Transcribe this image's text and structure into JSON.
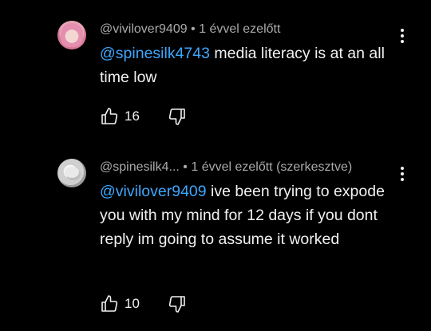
{
  "comments": [
    {
      "username": "@vivilover9409",
      "separator": " • ",
      "time": "1 évvel ezelőtt",
      "edited": "",
      "mention": "@spinesilk4743",
      "text": " media literacy is at an all time low",
      "likes": "16",
      "avatar_icon": "pink-hair-avatar-icon"
    },
    {
      "username": "@spinesilk4...",
      "separator": " • ",
      "time": "1 évvel ezelőtt",
      "edited": "(szerkesztve)",
      "mention": "@vivilover9409",
      "text": " ive been trying to expode you with my mind for 12 days if you dont reply im going to assume it worked",
      "likes": "10",
      "avatar_icon": "white-blob-avatar-icon"
    }
  ],
  "colors": {
    "background": "#000000",
    "text": "#f1f1f1",
    "meta": "#aaaaaa",
    "mention": "#3ea6ff"
  }
}
